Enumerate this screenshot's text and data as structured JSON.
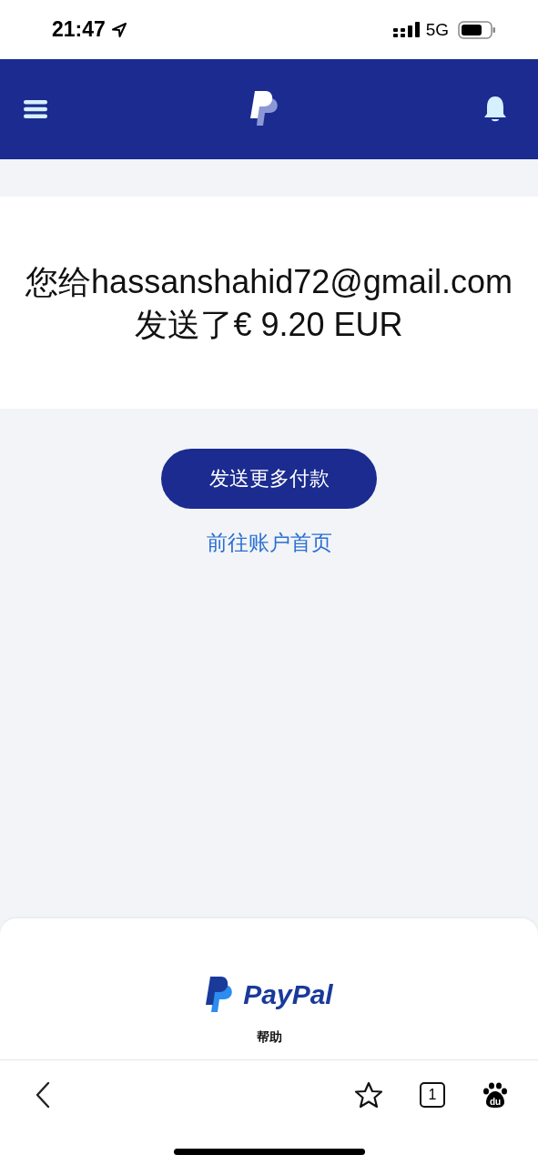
{
  "status_bar": {
    "time": "21:47",
    "network": "5G"
  },
  "message": {
    "title": "您给hassanshahid72@gmail.com发送了€ 9.20 EUR"
  },
  "actions": {
    "primary_button": "发送更多付款",
    "link": "前往账户首页"
  },
  "footer": {
    "brand": "PayPal",
    "help": "帮助"
  },
  "browser_toolbar": {
    "tab_count": "1",
    "baidu_label": "du"
  }
}
